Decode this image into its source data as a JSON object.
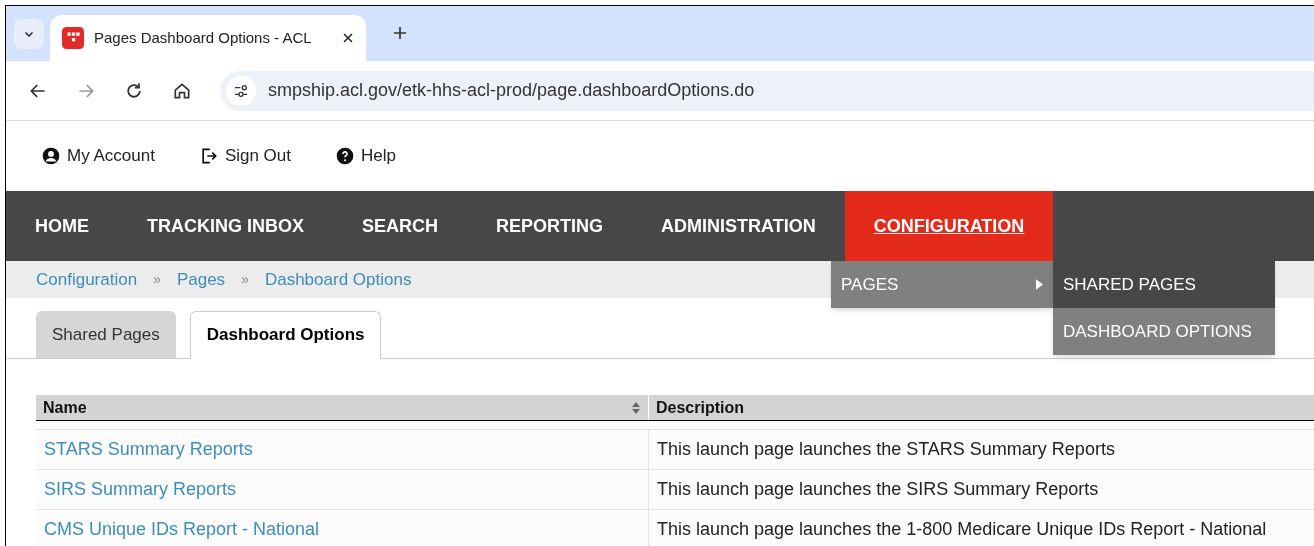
{
  "browser": {
    "tab_title": "Pages Dashboard Options - ACL",
    "url": "smpship.acl.gov/etk-hhs-acl-prod/page.dashboardOptions.do"
  },
  "top_links": [
    {
      "kind": "account",
      "label": "My Account"
    },
    {
      "kind": "signout",
      "label": "Sign Out"
    },
    {
      "kind": "help",
      "label": "Help"
    }
  ],
  "nav": [
    {
      "label": "HOME",
      "selected": false
    },
    {
      "label": "TRACKING INBOX",
      "selected": false
    },
    {
      "label": "SEARCH",
      "selected": false
    },
    {
      "label": "REPORTING",
      "selected": false
    },
    {
      "label": "ADMINISTRATION",
      "selected": false
    },
    {
      "label": "CONFIGURATION",
      "selected": true
    }
  ],
  "menu": {
    "label": "PAGES",
    "submenu": [
      {
        "label": "SHARED PAGES",
        "selected": true
      },
      {
        "label": "DASHBOARD OPTIONS",
        "selected": false
      }
    ]
  },
  "breadcrumb": [
    "Configuration",
    "Pages",
    "Dashboard Options"
  ],
  "breadcrumb_separator": "»",
  "tabs": [
    {
      "label": "Shared Pages",
      "selected": false
    },
    {
      "label": "Dashboard Options",
      "selected": true
    }
  ],
  "table": {
    "columns": [
      "Name",
      "Description"
    ],
    "rows": [
      {
        "name": "STARS Summary Reports",
        "description": "This launch page launches the STARS Summary Reports"
      },
      {
        "name": "SIRS Summary Reports",
        "description": "This launch page launches the SIRS Summary Reports"
      },
      {
        "name": "CMS Unique IDs Report - National",
        "description": "This launch page launches the 1-800 Medicare Unique IDs Report - National"
      }
    ]
  }
}
